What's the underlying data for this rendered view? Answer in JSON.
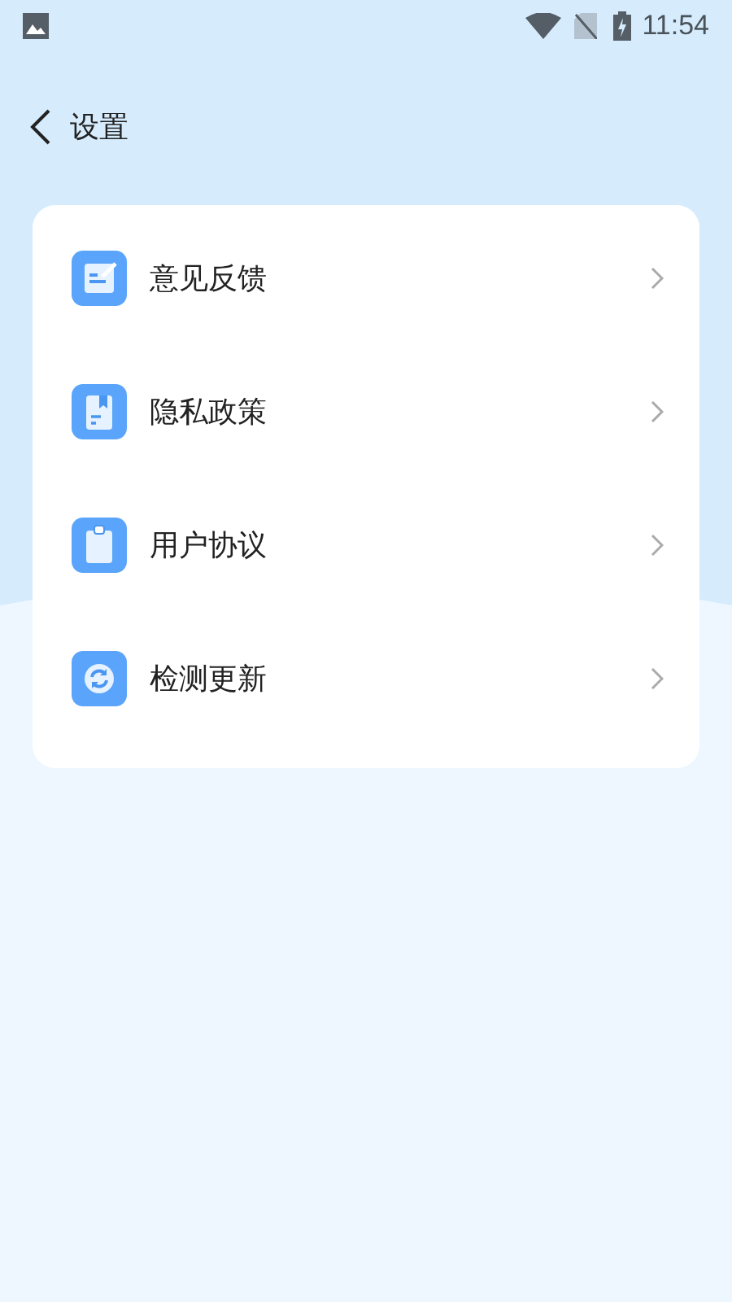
{
  "status_bar": {
    "time": "11:54"
  },
  "header": {
    "title": "设置"
  },
  "menu": [
    {
      "kind": "feedback",
      "label": "意见反馈"
    },
    {
      "kind": "privacy",
      "label": "隐私政策"
    },
    {
      "kind": "agreement",
      "label": "用户协议"
    },
    {
      "kind": "update",
      "label": "检测更新"
    }
  ]
}
